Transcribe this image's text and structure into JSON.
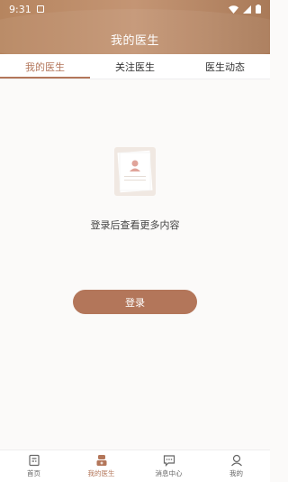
{
  "status_bar": {
    "time": "9:31"
  },
  "header": {
    "title": "我的医生"
  },
  "tabs": [
    {
      "label": "我的医生",
      "active": true
    },
    {
      "label": "关注医生",
      "active": false
    },
    {
      "label": "医生动态",
      "active": false
    }
  ],
  "empty_state": {
    "icon": "document-avatar-icon",
    "message": "登录后查看更多内容"
  },
  "login_button": {
    "label": "登录"
  },
  "bottom_nav": [
    {
      "label": "首页",
      "icon": "home-icon",
      "active": false
    },
    {
      "label": "我的医生",
      "icon": "doctor-icon",
      "active": true
    },
    {
      "label": "消息中心",
      "icon": "message-icon",
      "active": false
    },
    {
      "label": "我的",
      "icon": "profile-icon",
      "active": false
    }
  ],
  "colors": {
    "accent": "#b3765a",
    "header_gradient_start": "#b6855f",
    "header_gradient_end": "#a97a58"
  }
}
